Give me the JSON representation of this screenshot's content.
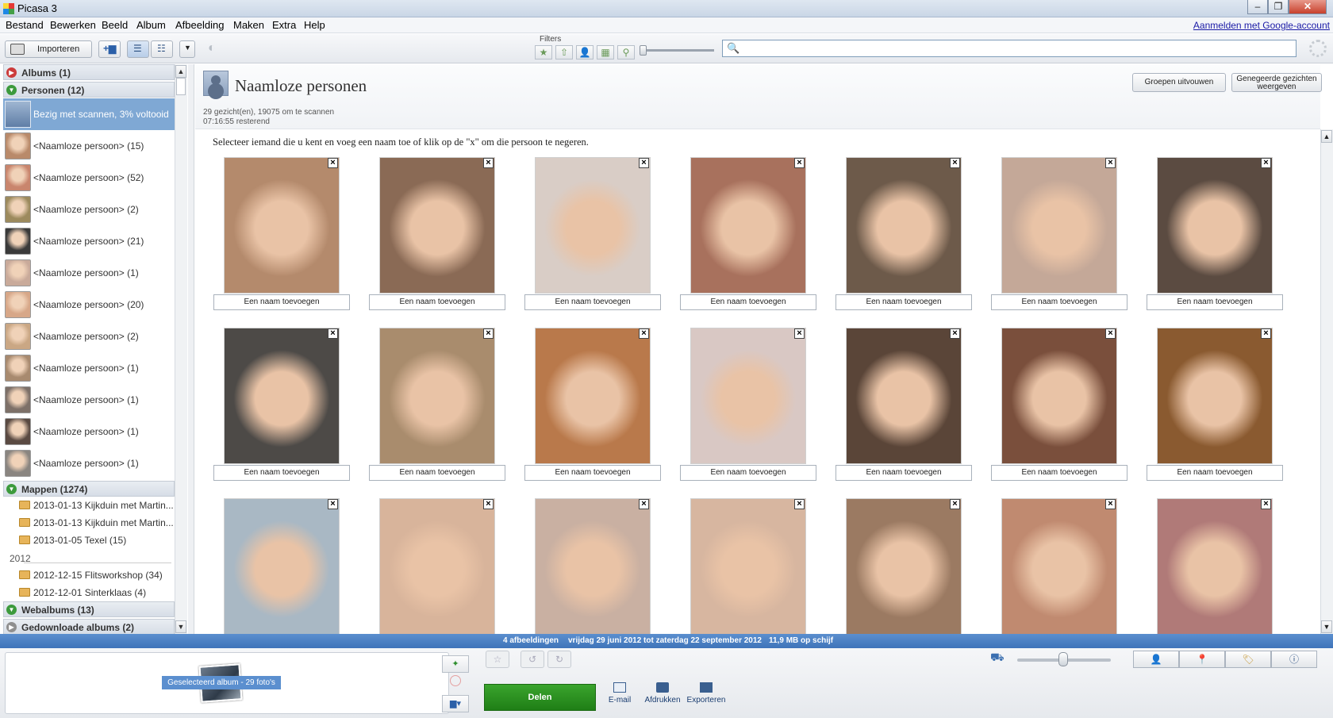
{
  "window": {
    "title": "Picasa 3",
    "controls": [
      "–",
      "❐",
      "✕"
    ]
  },
  "menu": [
    "Bestand",
    "Bewerken",
    "Beeld",
    "Album",
    "Afbeelding",
    "Maken",
    "Extra",
    "Help"
  ],
  "account": {
    "signin_label": "Aanmelden met Google-account"
  },
  "toolbar": {
    "import_label": "Importeren",
    "filters_label": "Filters",
    "search_placeholder": ""
  },
  "sidebar": {
    "albums_label": "Albums (1)",
    "persons_label": "Personen (12)",
    "scan_status": "Bezig met scannen, 3% voltooid",
    "persons": [
      {
        "label": "<Naamloze persoon> (15)",
        "color": "#b98a6a"
      },
      {
        "label": "<Naamloze persoon> (52)",
        "color": "#c9856d"
      },
      {
        "label": "<Naamloze persoon> (2)",
        "color": "#9c8a5d"
      },
      {
        "label": "<Naamloze persoon> (21)",
        "color": "#3a3a3a"
      },
      {
        "label": "<Naamloze persoon> (1)",
        "color": "#c9aa9a"
      },
      {
        "label": "<Naamloze persoon> (20)",
        "color": "#d7a788"
      },
      {
        "label": "<Naamloze persoon> (2)",
        "color": "#caa784"
      },
      {
        "label": "<Naamloze persoon> (1)",
        "color": "#a88a6f"
      },
      {
        "label": "<Naamloze persoon> (1)",
        "color": "#7d7068"
      },
      {
        "label": "<Naamloze persoon> (1)",
        "color": "#5a4a42"
      },
      {
        "label": "<Naamloze persoon> (1)",
        "color": "#8a8580"
      }
    ],
    "folders_label": "Mappen (1274)",
    "folders": [
      {
        "label": "2013-01-13 Kijkduin met Martin..."
      },
      {
        "label": "2013-01-13 Kijkduin met Martin..."
      },
      {
        "label": "2013-01-05 Texel (15)"
      }
    ],
    "year_label": "2012",
    "folders_2012": [
      {
        "label": "2012-12-15 Flitsworkshop (34)"
      },
      {
        "label": "2012-12-01 Sinterklaas (4)"
      }
    ],
    "webalbums_label": "Webalbums (13)",
    "downloaded_label": "Gedownloade albums (2)"
  },
  "main": {
    "title": "Naamloze personen",
    "scan_status": "29 gezicht(en), 19075 om te scannen",
    "time_status": "07:16:55 resterend",
    "expand_groups_label": "Groepen uitvouwen",
    "ignored_faces_label": "Genegeerde gezichten weergeven",
    "instruction": "Selecteer iemand die u kent en voeg een naam toe of klik op de \"x\" om die persoon te negeren.",
    "add_name_label": "Een naam toevoegen",
    "faces": [
      {
        "color": "#b48a6c"
      },
      {
        "color": "#8a6a55"
      },
      {
        "color": "#d9cdc6"
      },
      {
        "color": "#a8715d"
      },
      {
        "color": "#6d5a4a"
      },
      {
        "color": "#c4a898"
      },
      {
        "color": "#5b4b41"
      },
      {
        "color": "#4d4a47"
      },
      {
        "color": "#a98c6d"
      },
      {
        "color": "#b9794b"
      },
      {
        "color": "#d9c8c4"
      },
      {
        "color": "#5a4538"
      },
      {
        "color": "#7a4f3c"
      },
      {
        "color": "#8a5a30"
      },
      {
        "color": "#a9b8c4"
      },
      {
        "color": "#d8b49b"
      },
      {
        "color": "#c9b0a2"
      },
      {
        "color": "#d7b6a0"
      },
      {
        "color": "#9b7a62"
      },
      {
        "color": "#c08a70"
      },
      {
        "color": "#b07a78"
      }
    ]
  },
  "status": {
    "count": "4 afbeeldingen",
    "dates": "vrijdag 29 juni 2012 tot zaterdag 22 september 2012",
    "size": "11,9 MB op schijf"
  },
  "tray": {
    "label": "Geselecteerd album - 29 foto's"
  },
  "actions": {
    "share_label": "Delen",
    "email_label": "E-mail",
    "print_label": "Afdrukken",
    "export_label": "Exporteren"
  }
}
